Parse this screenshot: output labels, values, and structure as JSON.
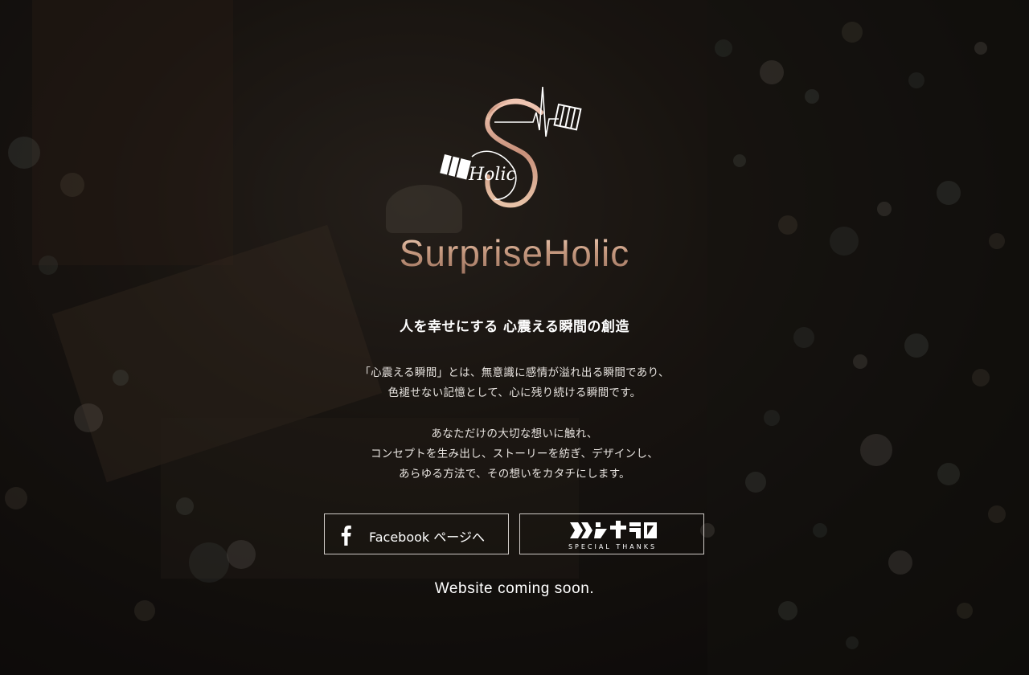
{
  "brand": {
    "name": "SurpriseHolic",
    "logo_script": "Holic"
  },
  "tagline": "人を幸せにする 心震える瞬間の創造",
  "intro": {
    "paragraph1": [
      "「心震える瞬間」とは、無意識に感情が溢れ出る瞬間であり、",
      "色褪せない記憶として、心に残り続ける瞬間です。"
    ],
    "paragraph2": [
      "あなただけの大切な想いに触れ、",
      "コンセプトを生み出し、ストーリーを紡ぎ、デザインし、",
      "あらゆる方法で、その想いをカタチにします。"
    ]
  },
  "buttons": {
    "facebook": {
      "label": "Facebook ページへ",
      "icon": "facebook-f-icon"
    },
    "special_thanks": {
      "label": "SPECIAL THANKS",
      "icon": "special-thanks-logo"
    }
  },
  "footer": {
    "coming_soon": "Website coming soon."
  },
  "colors": {
    "background": "#0e0c0a",
    "brand_gradient_top": "#f3d3bd",
    "brand_gradient_bottom": "#9e7460",
    "text": "#ffffff",
    "button_border": "#cfcac6"
  }
}
